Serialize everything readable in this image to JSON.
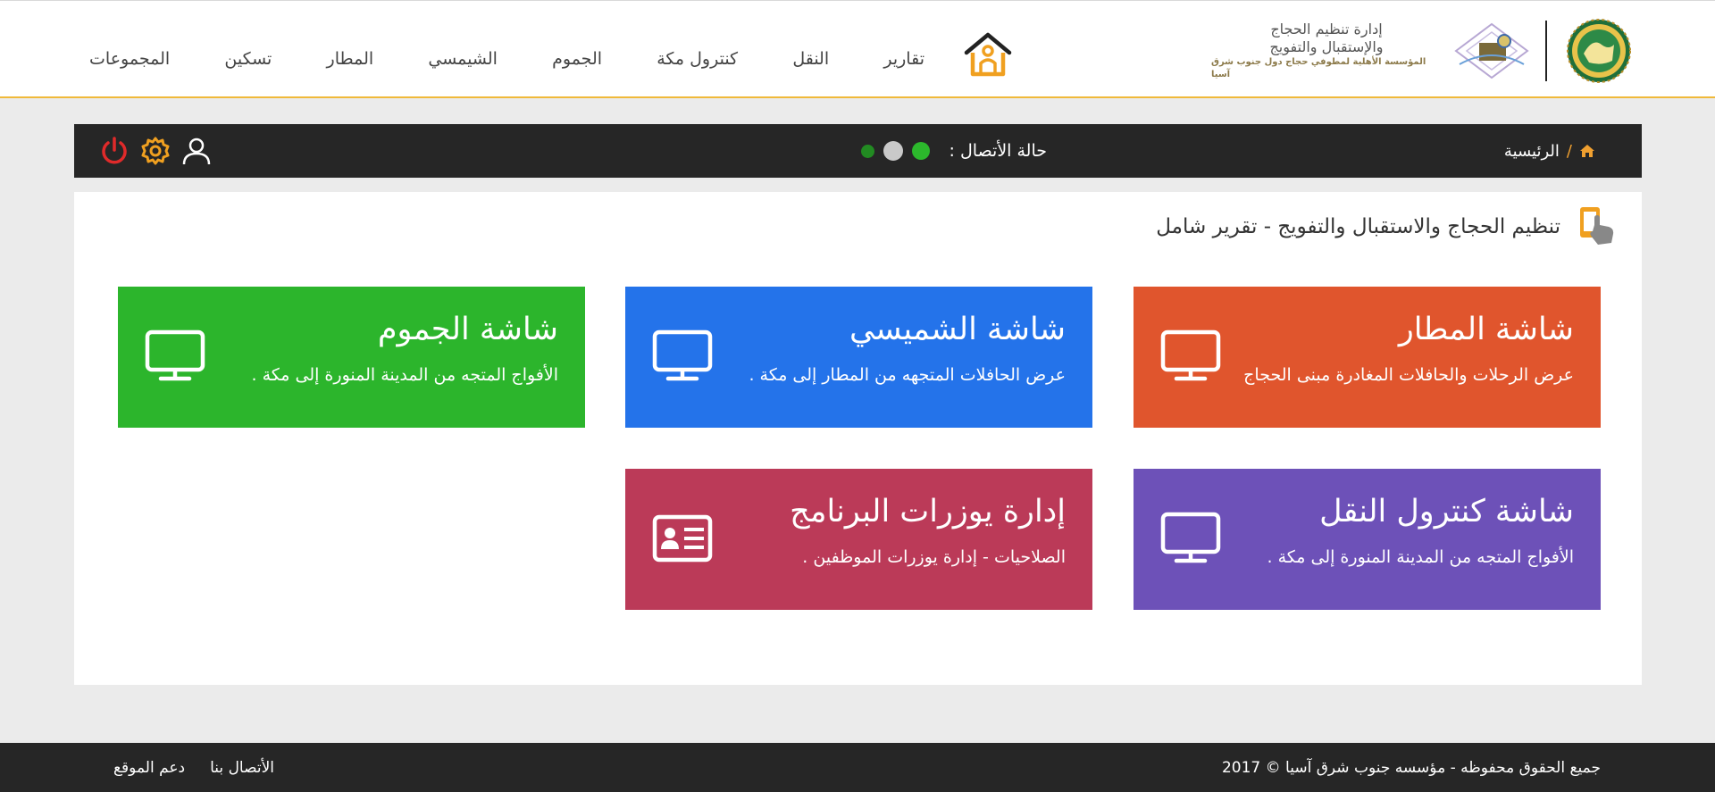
{
  "colors": {
    "accent": "#f0b93a",
    "dark_bar": "#262626",
    "tile_airport": "#e0552d",
    "tile_shumaisi": "#2473ea",
    "tile_jumum": "#2cb52c",
    "tile_transport": "#6d51b8",
    "tile_users": "#bb3a58",
    "status_on": "#2cb82c",
    "status_idle": "#c9c9c9",
    "status_dark": "#228b22"
  },
  "brand": {
    "line1": "إدارة تنظيم الحجاج",
    "line2": "والإستقبال والتفويج",
    "line3": "المؤسسة الأهلية لمطوفي حجاج دول جنوب شرق آسيا",
    "emblem_icon": "institution-emblem",
    "seal_icon": "organization-seal",
    "home_icon": "home-logo-icon"
  },
  "nav": {
    "items": [
      {
        "label": "المجموعات"
      },
      {
        "label": "تسكين"
      },
      {
        "label": "المطار"
      },
      {
        "label": "الشيمسي"
      },
      {
        "label": "الجموم"
      },
      {
        "label": "كنترول مكة"
      },
      {
        "label": "النقل"
      },
      {
        "label": "تقارير"
      }
    ]
  },
  "toolbar": {
    "breadcrumb_home": "الرئيسية",
    "breadcrumb_sep": "/",
    "connection_label": "حالة الأتصال :",
    "icons": [
      "user-icon",
      "gear-icon",
      "power-icon"
    ]
  },
  "section": {
    "title": "تنظيم الحجاج والاستقبال والتفويج - تقرير شامل",
    "icon": "tap-screen-icon"
  },
  "tiles": [
    {
      "title": "شاشة المطار",
      "desc": "عرض الرحلات والحافلات المغادرة مبنى الحجاج",
      "icon": "monitor-icon"
    },
    {
      "title": "شاشة الشميسي",
      "desc": "عرض الحافلات المتجهه من المطار إلى مكة .",
      "icon": "monitor-icon"
    },
    {
      "title": "شاشة الجموم",
      "desc": "الأفواج المتجه من المدينة المنورة إلى مكة .",
      "icon": "monitor-icon"
    },
    {
      "title": "شاشة كنترول النقل",
      "desc": "الأفواج المتجه من المدينة المنورة إلى مكة .",
      "icon": "monitor-icon"
    },
    {
      "title": "إدارة يوزرات البرنامج",
      "desc": "الصلاحيات - إدارة يوزرات الموظفين .",
      "icon": "id-card-icon"
    }
  ],
  "footer": {
    "copyright": "جميع الحقوق محفوظه - مؤسسه جنوب شرق آسيا © 2017",
    "links": [
      {
        "label": "الأتصال بنا"
      },
      {
        "label": "دعم الموقع"
      }
    ]
  }
}
